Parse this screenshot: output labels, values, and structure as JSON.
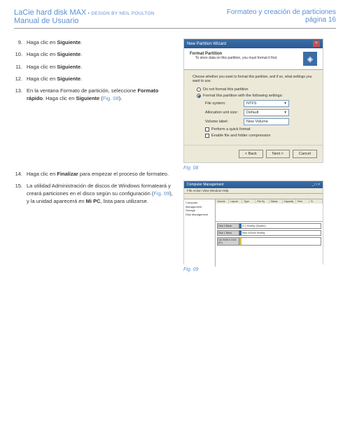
{
  "header": {
    "product": "LaCie hard disk MAX",
    "design": "• DESIGN BY NEIL POULTON",
    "manual": "Manual de Usuario",
    "section": "Formateo y creación de particiones",
    "page": "página 16"
  },
  "steps_a": [
    {
      "num": "9.",
      "pre": "Haga clic en ",
      "bold": "Siguiente",
      "post": "."
    },
    {
      "num": "10.",
      "pre": "Haga clic en ",
      "bold": "Siguiente",
      "post": "."
    },
    {
      "num": "11.",
      "pre": "Haga clic en ",
      "bold": "Siguiente",
      "post": "."
    },
    {
      "num": "12.",
      "pre": "Haga clic en ",
      "bold": "Siguiente",
      "post": "."
    }
  ],
  "step13": {
    "num": "13.",
    "text_a": "En la ventana Formato de partición, seleccione ",
    "bold_a": "Formato rápido",
    "text_b": ". Haga clic en ",
    "bold_b": "Siguiente",
    "text_c": " (",
    "figref": "Fig. 08",
    "text_d": ")."
  },
  "step14": {
    "num": "14.",
    "text_a": "Haga clic en ",
    "bold_a": "Finalizar",
    "text_b": " para empezar el proceso de formateo."
  },
  "step15": {
    "num": "15.",
    "text_a": "La utilidad Administración de discos de Windows formateará y creará particiones en el disco según su configuración (",
    "figref": "Fig. 09",
    "text_b": "), y la unidad aparecerá en ",
    "bold_a": "Mi PC",
    "text_c": ", lista para utilizarse."
  },
  "fig08": {
    "title": "New Partition Wizard",
    "heading": "Format Partition",
    "subheading": "To store data on this partition, you must format it first.",
    "prompt": "Choose whether you want to format this partition, and if so, what settings you want to use.",
    "radio1": "Do not format this partition",
    "radio2": "Format this partition with the following settings:",
    "row_fs_label": "File system:",
    "row_fs_value": "NTFS",
    "row_au_label": "Allocation unit size:",
    "row_au_value": "Default",
    "row_vl_label": "Volume label:",
    "row_vl_value": "New Volume",
    "chk1": "Perform a quick format",
    "chk2": "Enable file and folder compression",
    "btn_back": "< Back",
    "btn_next": "Next >",
    "btn_cancel": "Cancel",
    "caption": "Fig. 08"
  },
  "fig09": {
    "title": "Computer Management",
    "menu": "File   Action   View   Window   Help",
    "tree": [
      "Computer Management",
      " Storage",
      "  Disk Management"
    ],
    "cols": [
      "Volume",
      "Layout",
      "Type",
      "File Sy",
      "Status",
      "Capacity",
      "Free",
      "%"
    ],
    "disk0": {
      "label": "Disk 0\nBasic",
      "part": "(C:)\nHealthy (System)"
    },
    "disk1": {
      "label": "Disk 1\nBasic",
      "part": "New Volume\nHealthy"
    },
    "cd": {
      "label": "CD-ROM 0\nDVD (D:)",
      "part": ""
    },
    "caption": "Fig. 09"
  }
}
